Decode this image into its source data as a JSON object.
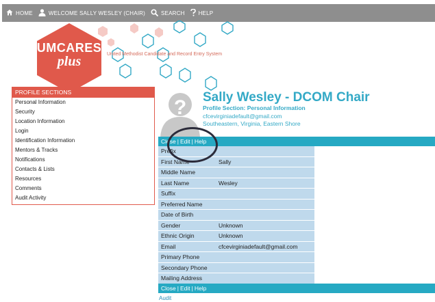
{
  "nav": {
    "home": "HOME",
    "welcome": "WELCOME SALLY  WESLEY (CHAIR)",
    "search": "SEARCH",
    "help": "HELP"
  },
  "logo": {
    "main": "UMCARES",
    "sub": "plus",
    "tagline": "United Methodist Candidate and Record Entry System"
  },
  "sidebar": {
    "header": "PROFILE SECTIONS",
    "items": [
      {
        "label": "Personal Information"
      },
      {
        "label": "Security"
      },
      {
        "label": "Location Information"
      },
      {
        "label": "Login"
      },
      {
        "label": "Identification Information"
      },
      {
        "label": "Mentors & Tracks"
      },
      {
        "label": "Notifications"
      },
      {
        "label": "Contacts & Lists"
      },
      {
        "label": "Resources"
      },
      {
        "label": "Comments"
      },
      {
        "label": "Audit Activity"
      }
    ]
  },
  "profile": {
    "name": "Sally Wesley - DCOM Chair",
    "section": "Profile Section: Personal Information",
    "email": "cfcevirginiadefault@gmail.com",
    "region": "Southeastern, Virginia, Eastern Shore"
  },
  "actions": {
    "close": "Close",
    "edit": "Edit",
    "help": "Help",
    "separator": "|"
  },
  "fields": [
    {
      "label": "Prefix",
      "value": ""
    },
    {
      "label": "First Name",
      "value": "Sally"
    },
    {
      "label": "Middle Name",
      "value": ""
    },
    {
      "label": "Last Name",
      "value": "Wesley"
    },
    {
      "label": "Suffix",
      "value": ""
    },
    {
      "label": "Preferred Name",
      "value": ""
    },
    {
      "label": "Date of Birth",
      "value": ""
    },
    {
      "label": "Gender",
      "value": "Unknown"
    },
    {
      "label": "Ethnic Origin",
      "value": "Unknown"
    },
    {
      "label": "Email",
      "value": "cfcevirginiadefault@gmail.com"
    },
    {
      "label": "Primary Phone",
      "value": ""
    },
    {
      "label": "Secondary Phone",
      "value": ""
    },
    {
      "label": "Mailing Address",
      "value": ""
    }
  ],
  "audit": "Audit",
  "colors": {
    "brand_red": "#e0594b",
    "accent_teal": "#26a9c3",
    "nav_gray": "#8e8e8e",
    "field_blue": "#bfd9ec"
  },
  "icons": [
    "home-icon",
    "user-icon",
    "search-icon",
    "help-icon",
    "avatar-placeholder-icon"
  ]
}
